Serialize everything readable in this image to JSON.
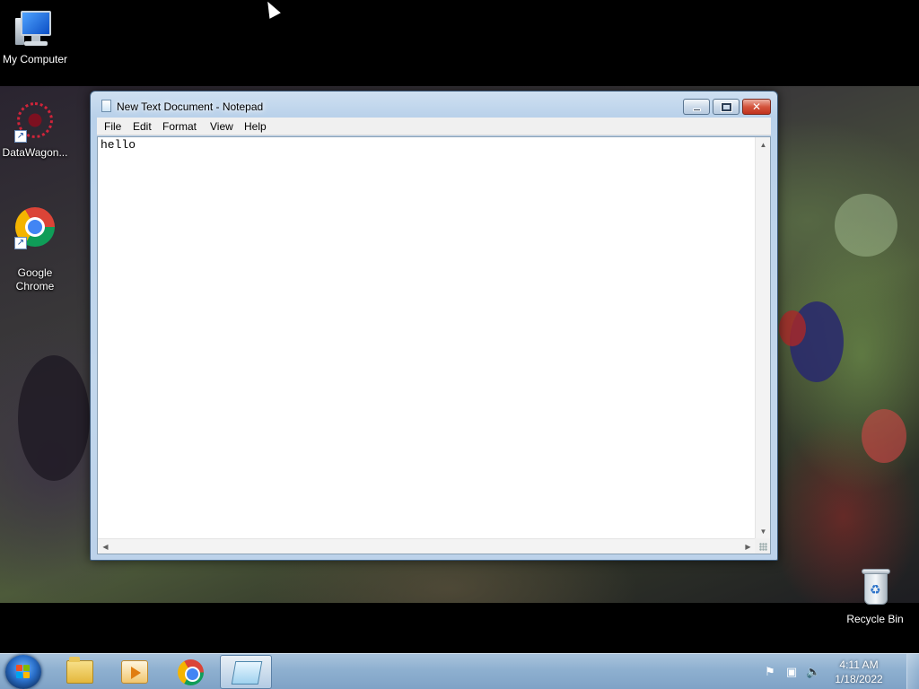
{
  "desktop": {
    "icons": [
      {
        "label": "My Computer",
        "icon": "computer-icon"
      },
      {
        "label": "DataWagon...",
        "icon": "datawagon-icon"
      },
      {
        "label": "Google\nChrome",
        "icon": "chrome-icon"
      },
      {
        "label": "Recycle Bin",
        "icon": "recycle-bin-icon"
      }
    ]
  },
  "window": {
    "title": "New Text Document - Notepad",
    "icon": "notepad-icon",
    "buttons": {
      "minimize": "minimize-icon",
      "maximize": "maximize-icon",
      "close": "close-icon"
    },
    "close_glyph": "✕",
    "menu": [
      "File",
      "Edit",
      "Format",
      "View",
      "Help"
    ],
    "content": "hello"
  },
  "scroll_glyphs": {
    "up": "▲",
    "down": "▼",
    "left": "◀",
    "right": "▶"
  },
  "taskbar": {
    "start_icon": "windows-start-icon",
    "pinned": [
      "file-explorer-icon",
      "media-player-icon",
      "chrome-icon",
      "notepad-icon"
    ],
    "active": "notepad-icon",
    "tray": {
      "icons": [
        "action-center-flag-icon",
        "network-icon",
        "volume-icon"
      ],
      "glyphs": {
        "flag": "⚑",
        "network": "▣",
        "volume": "🔈"
      },
      "time": "4:11 AM",
      "date": "1/18/2022"
    }
  },
  "colors": {
    "taskbar": "#8eb0d0",
    "close_button": "#d4553e",
    "window_frame": "#b9d1ea"
  }
}
